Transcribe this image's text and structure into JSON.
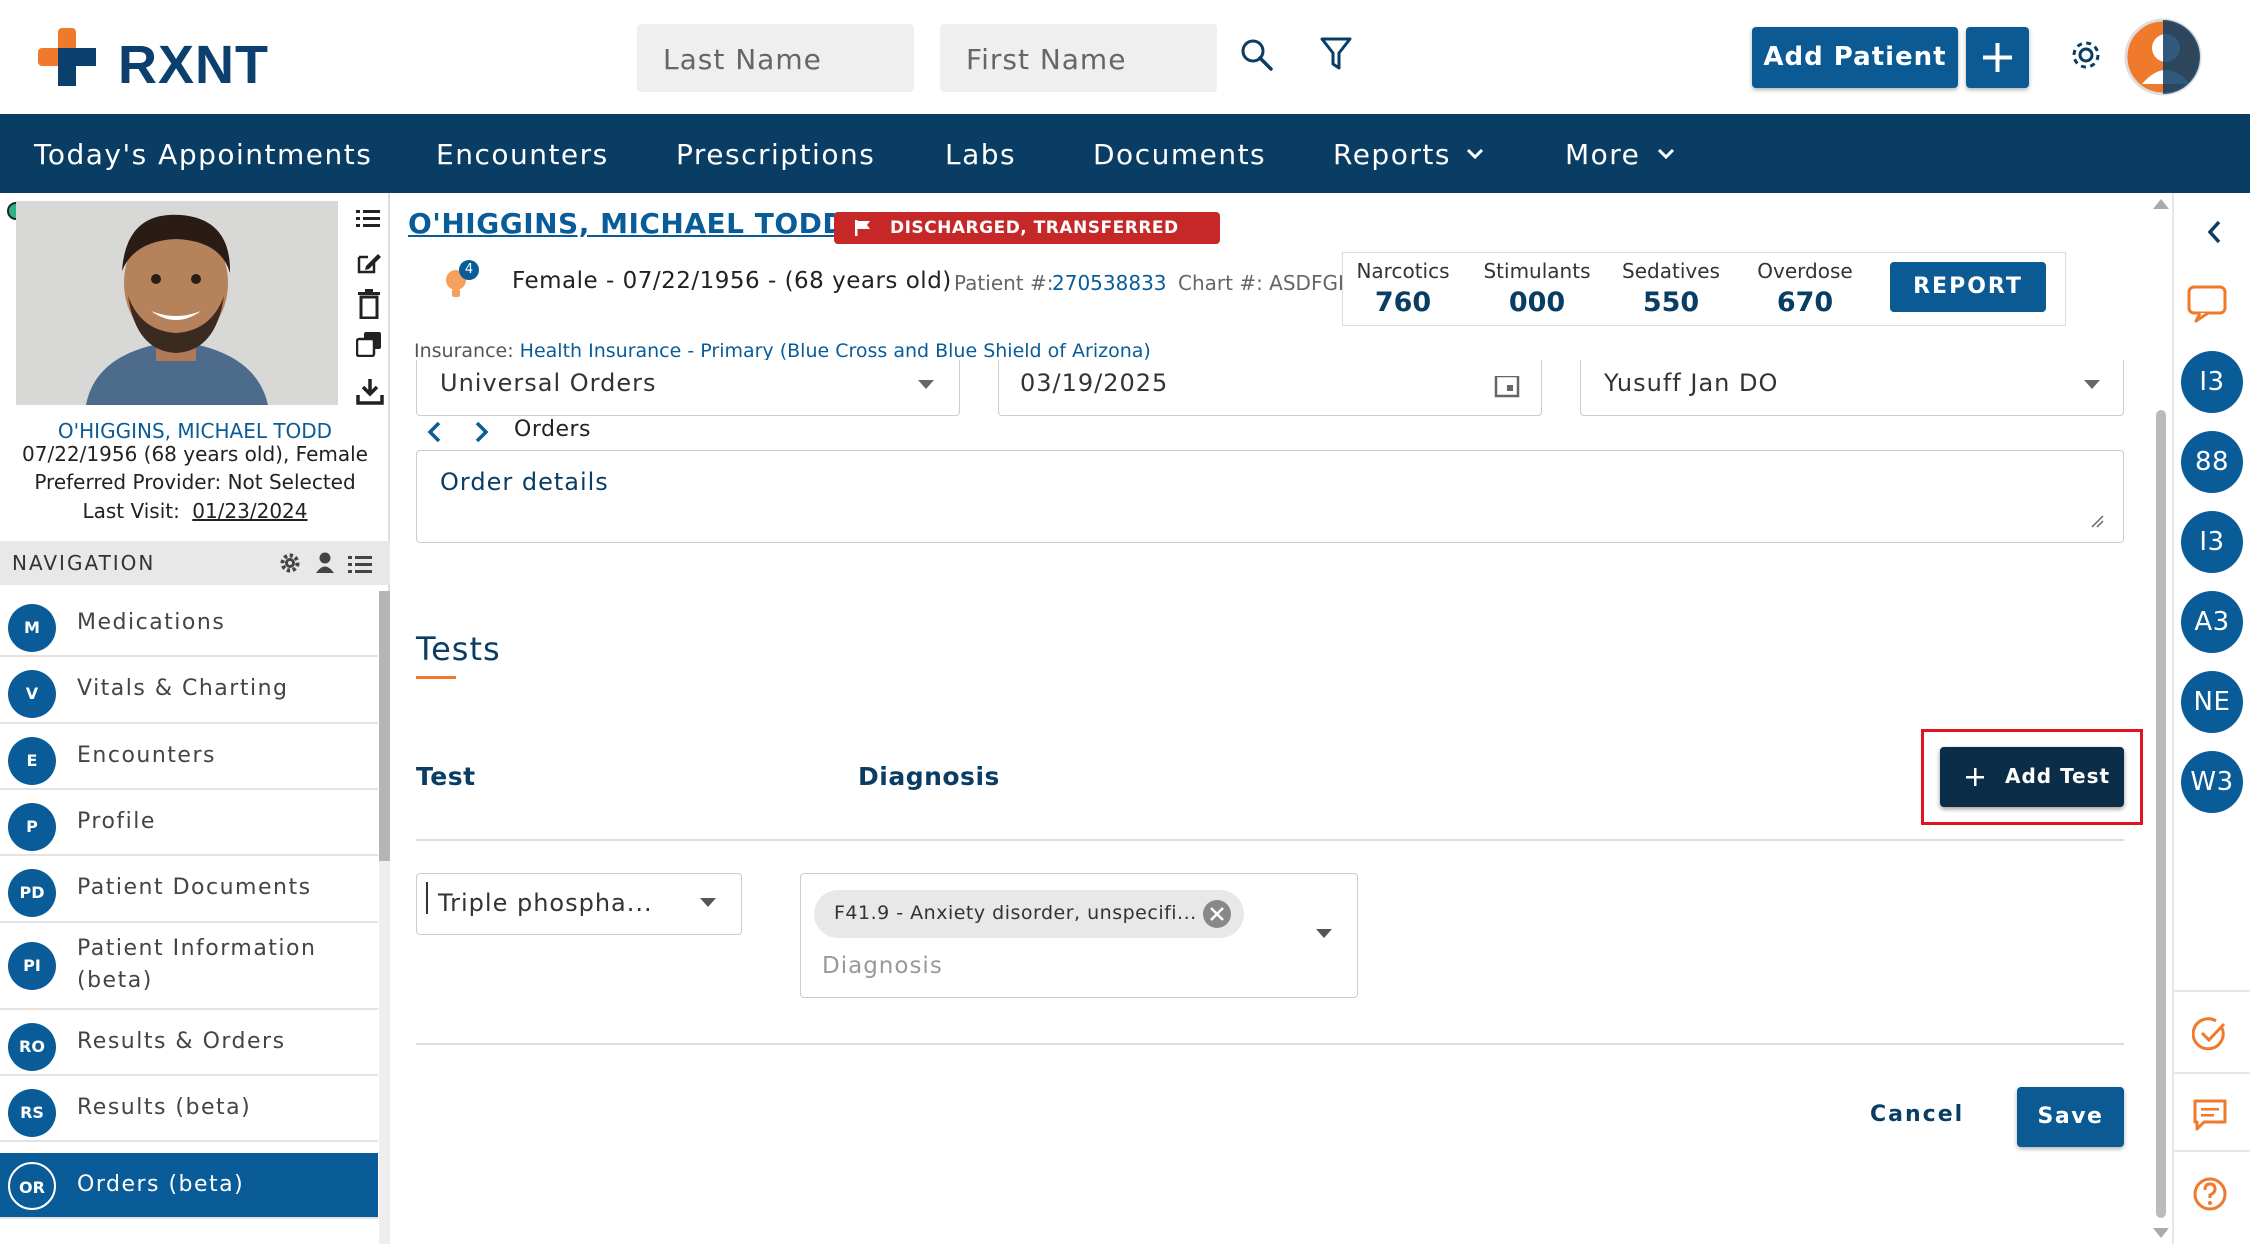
{
  "header": {
    "logo_text": "RXNT",
    "last_name_placeholder": "Last Name",
    "first_name_placeholder": "First Name",
    "add_patient_label": "Add Patient"
  },
  "nav": {
    "items": [
      "Today's Appointments",
      "Encounters",
      "Prescriptions",
      "Labs",
      "Documents",
      "Reports",
      "More"
    ]
  },
  "sidebar": {
    "patient_name": "O'HIGGINS, MICHAEL TODD",
    "dob_line": "07/22/1956 (68 years old), Female",
    "provider_line": "Preferred Provider: Not Selected",
    "last_visit_label": "Last Visit:",
    "last_visit_date": "01/23/2024",
    "nav_header": "NAVIGATION",
    "nav_items": [
      {
        "abbr": "M",
        "label": "Medications"
      },
      {
        "abbr": "V",
        "label": "Vitals & Charting"
      },
      {
        "abbr": "E",
        "label": "Encounters"
      },
      {
        "abbr": "P",
        "label": "Profile"
      },
      {
        "abbr": "PD",
        "label": "Patient Documents"
      },
      {
        "abbr": "PI",
        "label": "Patient Information (beta)"
      },
      {
        "abbr": "RO",
        "label": "Results & Orders"
      },
      {
        "abbr": "RS",
        "label": "Results (beta)"
      },
      {
        "abbr": "OR",
        "label": "Orders (beta)"
      }
    ]
  },
  "patient": {
    "name": "O'HIGGINS, MICHAEL TODD",
    "status_badge": "DISCHARGED, TRANSFERRED CARE",
    "alert_count": "4",
    "demographics": "Female - 07/22/1956 - (68 years old)",
    "patient_num_label": "Patient #:",
    "patient_num": "270538833",
    "chart_label": "Chart #: ASDFGHJ",
    "insurance_label": "Insurance:",
    "insurance_value": "Health Insurance - Primary (Blue Cross and Blue Shield of Arizona)",
    "stats": [
      {
        "label": "Narcotics",
        "value": "760"
      },
      {
        "label": "Stimulants",
        "value": "000"
      },
      {
        "label": "Sedatives",
        "value": "550"
      },
      {
        "label": "Overdose",
        "value": "670"
      }
    ],
    "report_label": "REPORT"
  },
  "order_form": {
    "order_type": "Universal Orders",
    "order_date": "03/19/2025",
    "provider": "Yusuff Jan DO",
    "breadcrumb": "Orders",
    "details_placeholder": "Order details",
    "tests_title": "Tests",
    "col_test": "Test",
    "col_diagnosis": "Diagnosis",
    "add_test_label": "Add Test",
    "test_value": "Triple phospha...",
    "diagnosis_chip": "F41.9 - Anxiety disorder, unspecifi...",
    "diagnosis_placeholder": "Diagnosis",
    "cancel_label": "Cancel",
    "save_label": "Save"
  },
  "rail": {
    "items": [
      "I3",
      "88",
      "I3",
      "A3",
      "NE",
      "W3"
    ]
  },
  "colors": {
    "primary": "#0b5a93",
    "navbar": "#0a3d64",
    "badge_red": "#c62828",
    "accent_orange": "#f07a2b",
    "highlight_red": "#e0141f"
  }
}
